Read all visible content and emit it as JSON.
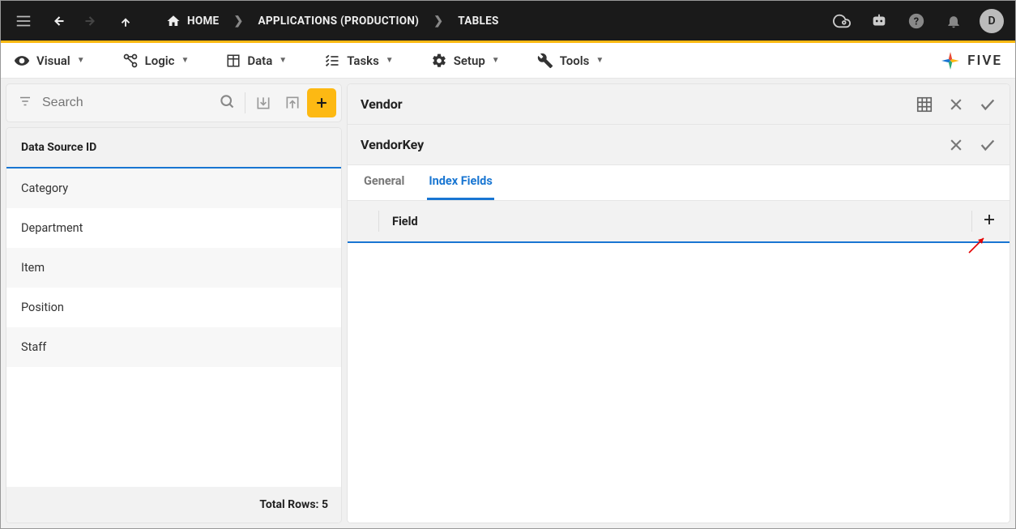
{
  "topbar": {
    "breadcrumb": {
      "home": "HOME",
      "level1": "APPLICATIONS (PRODUCTION)",
      "level2": "TABLES"
    },
    "avatar_initial": "D"
  },
  "menubar": {
    "items": [
      {
        "label": "Visual"
      },
      {
        "label": "Logic"
      },
      {
        "label": "Data"
      },
      {
        "label": "Tasks"
      },
      {
        "label": "Setup"
      },
      {
        "label": "Tools"
      }
    ],
    "brand": "FIVE"
  },
  "left": {
    "search_placeholder": "Search",
    "header": "Data Source ID",
    "items": [
      {
        "label": "Category"
      },
      {
        "label": "Department"
      },
      {
        "label": "Item"
      },
      {
        "label": "Position"
      },
      {
        "label": "Staff"
      }
    ],
    "footer_label": "Total Rows:",
    "footer_value": "5"
  },
  "right": {
    "section1": {
      "title": "Vendor"
    },
    "section2": {
      "title": "VendorKey"
    },
    "tabs": [
      {
        "label": "General",
        "active": false
      },
      {
        "label": "Index Fields",
        "active": true
      }
    ],
    "field_column": "Field"
  }
}
